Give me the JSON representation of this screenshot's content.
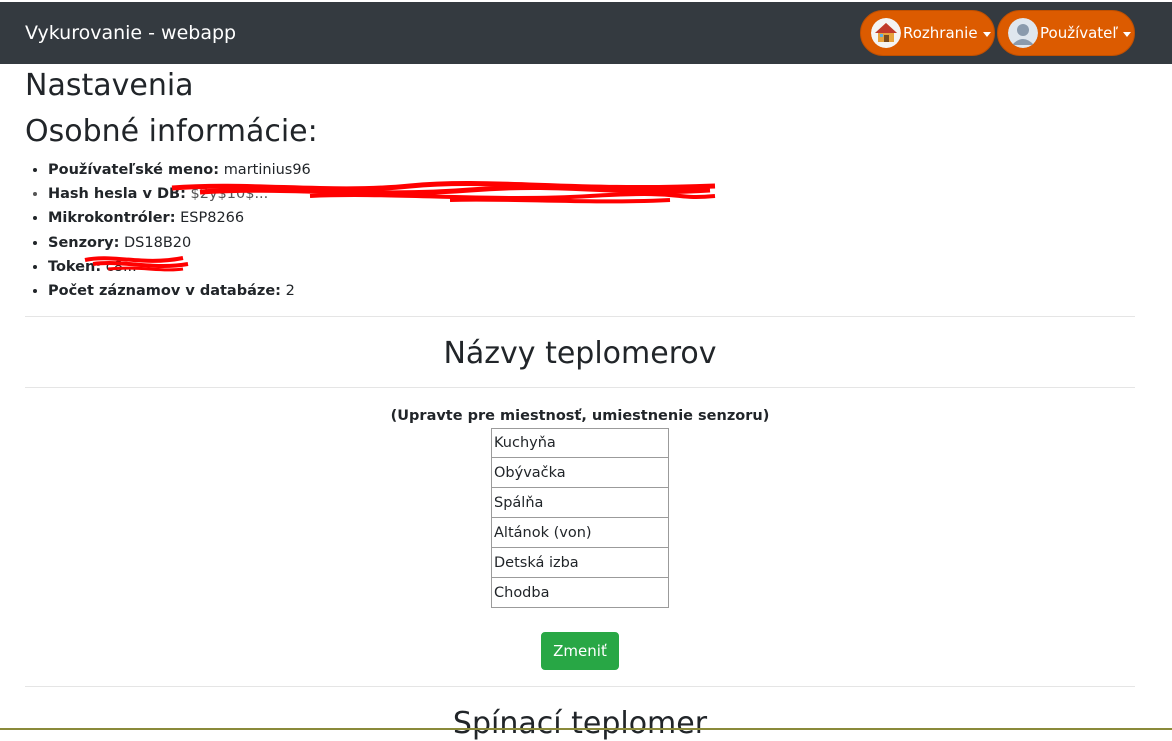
{
  "navbar": {
    "brand": "Vykurovanie - webapp",
    "interface_label": "Rozhranie",
    "user_label": "Používateľ",
    "accent": "#dc5b00"
  },
  "page": {
    "title": "Nastavenia",
    "subtitle": "Osobné informácie:"
  },
  "info": {
    "username_label": "Používateľské meno:",
    "username_value": "martinius96",
    "hash_label": "Hash hesla v DB:",
    "hash_value": "$2y$10$...",
    "mcu_label": "Mikrokontróler:",
    "mcu_value": "ESP8266",
    "sensors_label": "Senzory:",
    "sensors_value": "DS18B20",
    "token_label": "Token:",
    "token_value": "c8...",
    "records_label": "Počet záznamov v databáze:",
    "records_value": "2"
  },
  "thermometers": {
    "title": "Názvy teplomerov",
    "hint": "(Upravte pre miestnosť, umiestnenie senzoru)",
    "names": [
      "Kuchyňa",
      "Obývačka",
      "Spálňa",
      "Altánok (von)",
      "Detská izba",
      "Chodba"
    ],
    "submit_label": "Zmeniť"
  },
  "switching": {
    "title": "Spínací teplomer"
  }
}
